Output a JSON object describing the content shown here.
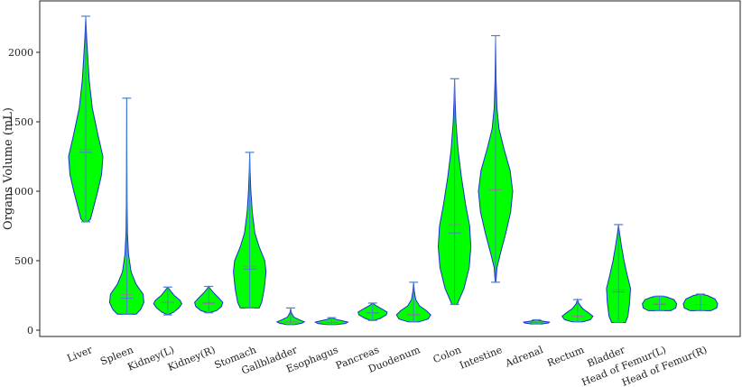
{
  "chart_data": {
    "type": "violin",
    "title": "",
    "xlabel": "",
    "ylabel": "Organs Volume (mL)",
    "ylim": [
      -50,
      2300
    ],
    "yticks": [
      0,
      500,
      1000,
      1500,
      2000
    ],
    "grid": false,
    "legend": "none",
    "colors": {
      "fill": "#00ff00",
      "outline": "#1a2fd0",
      "whisker": "#4a7fd4",
      "median": "#888888"
    },
    "categories": [
      "Liver",
      "Spleen",
      "Kidney(L)",
      "Kidney(R)",
      "Stomach",
      "Gallbladder",
      "Esophagus",
      "Pancreas",
      "Duodenum",
      "Colon",
      "Intestine",
      "Adrenal",
      "Rectum",
      "Bladder",
      "Head of Femur(L)",
      "Head of Femur(R)"
    ],
    "violins": [
      {
        "name": "Liver",
        "min": 780,
        "max": 2260,
        "mean": 1280,
        "median": 1300,
        "profile": [
          [
            780,
            0.12
          ],
          [
            800,
            0.28
          ],
          [
            880,
            0.45
          ],
          [
            1000,
            0.7
          ],
          [
            1120,
            0.92
          ],
          [
            1250,
            1.0
          ],
          [
            1400,
            0.72
          ],
          [
            1600,
            0.38
          ],
          [
            1800,
            0.2
          ],
          [
            2000,
            0.1
          ],
          [
            2100,
            0.05
          ],
          [
            2260,
            0.0
          ]
        ]
      },
      {
        "name": "Spleen",
        "min": 115,
        "max": 1670,
        "mean": 230,
        "median": 255,
        "profile": [
          [
            115,
            0.55
          ],
          [
            150,
            0.82
          ],
          [
            200,
            1.0
          ],
          [
            260,
            0.95
          ],
          [
            330,
            0.55
          ],
          [
            420,
            0.25
          ],
          [
            550,
            0.1
          ],
          [
            700,
            0.04
          ],
          [
            900,
            0.02
          ],
          [
            1200,
            0.01
          ],
          [
            1670,
            0.0
          ]
        ]
      },
      {
        "name": "Kidney(L)",
        "min": 110,
        "max": 310,
        "mean": 200,
        "median": 200,
        "profile": [
          [
            110,
            0.0
          ],
          [
            130,
            0.35
          ],
          [
            160,
            0.65
          ],
          [
            190,
            0.82
          ],
          [
            215,
            0.72
          ],
          [
            250,
            0.38
          ],
          [
            290,
            0.12
          ],
          [
            310,
            0.0
          ]
        ]
      },
      {
        "name": "Kidney(R)",
        "min": 125,
        "max": 315,
        "mean": 195,
        "median": 190,
        "profile": [
          [
            125,
            0.0
          ],
          [
            140,
            0.45
          ],
          [
            170,
            0.75
          ],
          [
            200,
            0.82
          ],
          [
            230,
            0.6
          ],
          [
            270,
            0.28
          ],
          [
            300,
            0.08
          ],
          [
            315,
            0.0
          ]
        ]
      },
      {
        "name": "Stomach",
        "min": 160,
        "max": 1280,
        "mean": 440,
        "median": 460,
        "profile": [
          [
            160,
            0.55
          ],
          [
            200,
            0.7
          ],
          [
            300,
            0.85
          ],
          [
            420,
            0.95
          ],
          [
            500,
            0.88
          ],
          [
            600,
            0.55
          ],
          [
            700,
            0.3
          ],
          [
            850,
            0.15
          ],
          [
            1000,
            0.07
          ],
          [
            1150,
            0.02
          ],
          [
            1280,
            0.0
          ]
        ]
      },
      {
        "name": "Gallbladder",
        "min": 40,
        "max": 160,
        "mean": 60,
        "median": 60,
        "profile": [
          [
            40,
            0.25
          ],
          [
            50,
            0.65
          ],
          [
            60,
            0.8
          ],
          [
            75,
            0.5
          ],
          [
            95,
            0.18
          ],
          [
            125,
            0.04
          ],
          [
            160,
            0.0
          ]
        ]
      },
      {
        "name": "Esophagus",
        "min": 40,
        "max": 90,
        "mean": 55,
        "median": 58,
        "profile": [
          [
            40,
            0.3
          ],
          [
            48,
            0.8
          ],
          [
            58,
            0.95
          ],
          [
            68,
            0.6
          ],
          [
            80,
            0.18
          ],
          [
            90,
            0.0
          ]
        ]
      },
      {
        "name": "Pancreas",
        "min": 70,
        "max": 195,
        "mean": 125,
        "median": 120,
        "profile": [
          [
            70,
            0.1
          ],
          [
            85,
            0.45
          ],
          [
            110,
            0.8
          ],
          [
            130,
            0.85
          ],
          [
            155,
            0.5
          ],
          [
            180,
            0.15
          ],
          [
            195,
            0.0
          ]
        ]
      },
      {
        "name": "Duodenum",
        "min": 60,
        "max": 345,
        "mean": 110,
        "median": 115,
        "profile": [
          [
            60,
            0.3
          ],
          [
            80,
            0.85
          ],
          [
            110,
            1.0
          ],
          [
            140,
            0.75
          ],
          [
            175,
            0.35
          ],
          [
            220,
            0.12
          ],
          [
            280,
            0.04
          ],
          [
            345,
            0.0
          ]
        ]
      },
      {
        "name": "Colon",
        "min": 185,
        "max": 1810,
        "mean": 700,
        "median": 760,
        "profile": [
          [
            185,
            0.15
          ],
          [
            300,
            0.55
          ],
          [
            450,
            0.85
          ],
          [
            600,
            0.95
          ],
          [
            750,
            0.88
          ],
          [
            900,
            0.65
          ],
          [
            1100,
            0.4
          ],
          [
            1300,
            0.2
          ],
          [
            1500,
            0.08
          ],
          [
            1650,
            0.03
          ],
          [
            1810,
            0.0
          ]
        ]
      },
      {
        "name": "Intestine",
        "min": 345,
        "max": 2120,
        "mean": 1010,
        "median": 1010,
        "profile": [
          [
            345,
            0.02
          ],
          [
            450,
            0.08
          ],
          [
            550,
            0.28
          ],
          [
            700,
            0.6
          ],
          [
            850,
            0.88
          ],
          [
            1000,
            1.0
          ],
          [
            1150,
            0.85
          ],
          [
            1300,
            0.5
          ],
          [
            1450,
            0.2
          ],
          [
            1600,
            0.08
          ],
          [
            1800,
            0.03
          ],
          [
            2120,
            0.0
          ]
        ]
      },
      {
        "name": "Adrenal",
        "min": 45,
        "max": 75,
        "mean": 55,
        "median": 58,
        "profile": [
          [
            45,
            0.3
          ],
          [
            52,
            0.7
          ],
          [
            58,
            0.75
          ],
          [
            65,
            0.35
          ],
          [
            75,
            0.0
          ]
        ]
      },
      {
        "name": "Rectum",
        "min": 60,
        "max": 220,
        "mean": 100,
        "median": 100,
        "profile": [
          [
            60,
            0.3
          ],
          [
            75,
            0.75
          ],
          [
            100,
            0.9
          ],
          [
            125,
            0.65
          ],
          [
            155,
            0.3
          ],
          [
            190,
            0.08
          ],
          [
            220,
            0.0
          ]
        ]
      },
      {
        "name": "Bladder",
        "min": 55,
        "max": 760,
        "mean": 275,
        "median": 290,
        "profile": [
          [
            55,
            0.4
          ],
          [
            100,
            0.55
          ],
          [
            200,
            0.65
          ],
          [
            300,
            0.7
          ],
          [
            400,
            0.5
          ],
          [
            500,
            0.32
          ],
          [
            600,
            0.18
          ],
          [
            700,
            0.06
          ],
          [
            760,
            0.0
          ]
        ]
      },
      {
        "name": "Head of Femur(L)",
        "min": 140,
        "max": 245,
        "mean": 185,
        "median": 190,
        "profile": [
          [
            140,
            0.65
          ],
          [
            160,
            0.95
          ],
          [
            190,
            1.0
          ],
          [
            220,
            0.85
          ],
          [
            240,
            0.4
          ],
          [
            245,
            0.0
          ]
        ]
      },
      {
        "name": "Head of Femur(R)",
        "min": 140,
        "max": 260,
        "mean": 185,
        "median": 185,
        "profile": [
          [
            140,
            0.6
          ],
          [
            160,
            0.95
          ],
          [
            190,
            1.0
          ],
          [
            225,
            0.85
          ],
          [
            250,
            0.4
          ],
          [
            260,
            0.0
          ]
        ]
      }
    ]
  }
}
